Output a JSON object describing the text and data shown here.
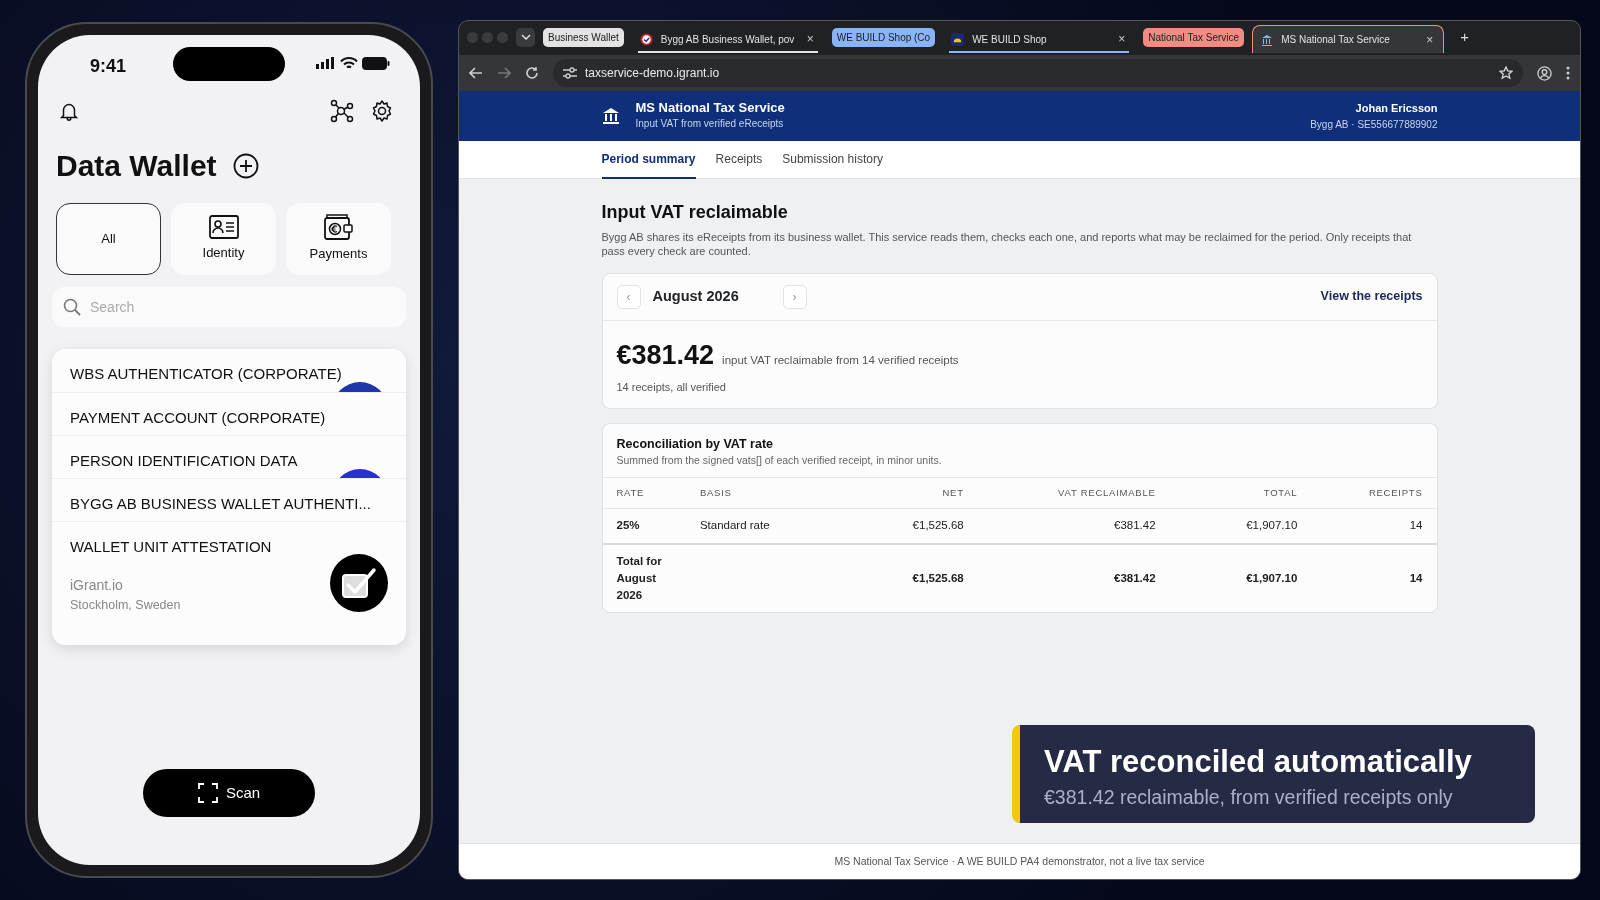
{
  "phone": {
    "time": "9:41",
    "title": "Data Wallet",
    "categories": [
      {
        "label": "All",
        "kind": "plain",
        "selected": true
      },
      {
        "label": "Identity",
        "kind": "identity",
        "selected": false
      },
      {
        "label": "Payments",
        "kind": "payments",
        "selected": false
      }
    ],
    "search": {
      "placeholder": "Search"
    },
    "cards": [
      {
        "title": "WBS AUTHENTICATOR (CORPORATE)",
        "color": "#1f35a8"
      },
      {
        "title": "PAYMENT ACCOUNT (CORPORATE)"
      },
      {
        "title": "PERSON IDENTIFICATION DATA",
        "color": "#2a2fd0"
      },
      {
        "title": "BYGG AB BUSINESS WALLET AUTHENTI..."
      },
      {
        "title": "WALLET UNIT ATTESTATION",
        "issuer": "iGrant.io",
        "location": "Stockholm, Sweden"
      }
    ],
    "scan_button": "Scan"
  },
  "browser": {
    "tabs": [
      {
        "kind": "group",
        "label": "Business Wallet",
        "color": "#e3e3e3"
      },
      {
        "kind": "tab",
        "title": "Bygg AB Business Wallet, pov",
        "close": "×",
        "selected": false
      },
      {
        "kind": "group",
        "label": "WE BUILD Shop (Co",
        "color": "#8ab4f8"
      },
      {
        "kind": "tab",
        "title": "WE BUILD Shop",
        "close": "×",
        "selected": false
      },
      {
        "kind": "group",
        "label": "National Tax Service",
        "color": "#f28b82"
      },
      {
        "kind": "tab",
        "title": "MS National Tax Service",
        "close": "×",
        "selected": true
      }
    ],
    "new_tab": "+",
    "url": "taxservice-demo.igrant.io"
  },
  "page": {
    "header": {
      "service": "MS National Tax Service",
      "subtitle": "Input VAT from verified eReceipts",
      "user": "Johan Ericsson",
      "org": "Bygg AB · SE556677889902"
    },
    "nav": [
      {
        "label": "Period summary",
        "selected": true
      },
      {
        "label": "Receipts",
        "selected": false
      },
      {
        "label": "Submission history",
        "selected": false
      }
    ],
    "heading": "Input VAT reclaimable",
    "description": "Bygg AB shares its eReceipts from its business wallet. This service reads them, checks each one, and reports what may be reclaimed for the period. Only receipts that pass every check are counted.",
    "period": {
      "prev": "‹",
      "month": "August 2026",
      "next": "›",
      "link": "View the receipts",
      "amount": "€381.42",
      "amount_caption": "input VAT reclaimable from 14 verified receipts",
      "status": "14 receipts, all verified"
    },
    "reconciliation": {
      "title": "Reconciliation by VAT rate",
      "subtitle": "Summed from the signed vats[] of each verified receipt, in minor units.",
      "columns": [
        "RATE",
        "BASIS",
        "NET",
        "VAT RECLAIMABLE",
        "TOTAL",
        "RECEIPTS"
      ],
      "rows": [
        {
          "kind": "rate",
          "cells": [
            "25%",
            "Standard rate",
            "€1,525.68",
            "€381.42",
            "€1,907.10",
            "14"
          ]
        },
        {
          "kind": "total",
          "cells": [
            "Total for August 2026",
            "",
            "€1,525.68",
            "€381.42",
            "€1,907.10",
            "14"
          ]
        }
      ]
    },
    "toast": {
      "title": "VAT reconciled automatically",
      "text": "€381.42 reclaimable, from verified receipts only"
    },
    "footer": "MS National Tax Service · A WE BUILD PA4 demonstrator, not a live tax service"
  }
}
